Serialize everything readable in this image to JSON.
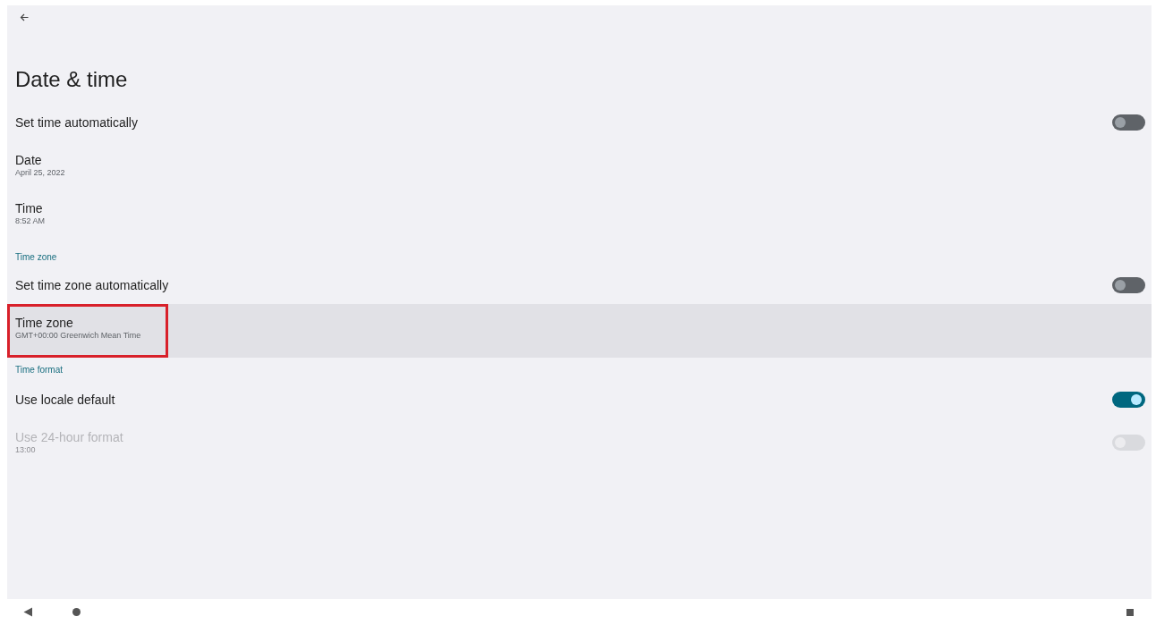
{
  "screen": {
    "title": "Date & time"
  },
  "items": [
    {
      "kind": "switch",
      "title": "Set time automatically",
      "on": false,
      "disabled": false,
      "selected": false,
      "annotated": false
    },
    {
      "kind": "entry",
      "title": "Date",
      "summary": "April 25, 2022",
      "disabled": false,
      "selected": false,
      "annotated": false
    },
    {
      "kind": "entry",
      "title": "Time",
      "summary": "8:52 AM",
      "disabled": false,
      "selected": false,
      "annotated": false
    },
    {
      "kind": "header",
      "title": "Time zone"
    },
    {
      "kind": "switch",
      "title": "Set time zone automatically",
      "on": false,
      "disabled": false,
      "selected": false,
      "annotated": false
    },
    {
      "kind": "entry",
      "title": "Time zone",
      "summary": "GMT+00:00 Greenwich Mean Time",
      "disabled": false,
      "selected": true,
      "annotated": true
    },
    {
      "kind": "header",
      "title": "Time format"
    },
    {
      "kind": "switch",
      "title": "Use locale default",
      "on": true,
      "disabled": false,
      "selected": false,
      "annotated": false
    },
    {
      "kind": "switch",
      "title": "Use 24-hour format",
      "summary": "13:00",
      "on": false,
      "disabled": true,
      "selected": false,
      "annotated": false
    }
  ]
}
